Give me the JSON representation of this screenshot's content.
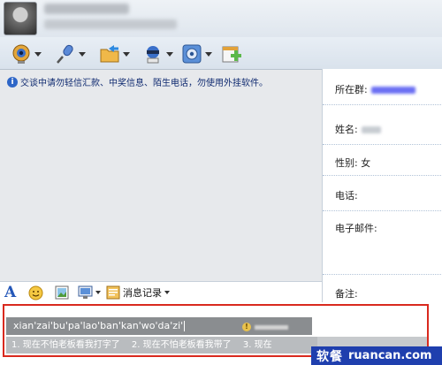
{
  "notice": {
    "text": "交谈中请勿轻信汇款、中奖信息、陌生电话，勿使用外挂软件。"
  },
  "contact_info": {
    "group_label": "所在群:",
    "name_label": "姓名:",
    "gender_label": "性别:",
    "gender_value": "女",
    "phone_label": "电话:",
    "email_label": "电子邮件:",
    "note_label": "备注:"
  },
  "input_toolbar": {
    "history_label": "消息记录"
  },
  "ime": {
    "composition": "xian'zai'bu'pa'lao'ban'kan'wo'da'zi'",
    "candidates": [
      "1. 现在不怕老板看我打字了",
      "2. 现在不怕老板看我带了",
      "3. 现在"
    ]
  },
  "watermark": {
    "cn": "软餐",
    "en": "ruancan.com"
  },
  "icons": {
    "toolbar": [
      "webcam-icon",
      "microphone-icon",
      "send-file-icon",
      "agent-icon",
      "app-settings-icon",
      "add-app-icon"
    ],
    "input_toolbar": [
      "font-icon",
      "emoticon-icon",
      "picture-icon",
      "screen-capture-icon",
      "history-icon"
    ]
  },
  "colors": {
    "highlight_frame": "#d9291e",
    "link": "#3c3cf0",
    "watermark_bg": "#1f3fae"
  }
}
